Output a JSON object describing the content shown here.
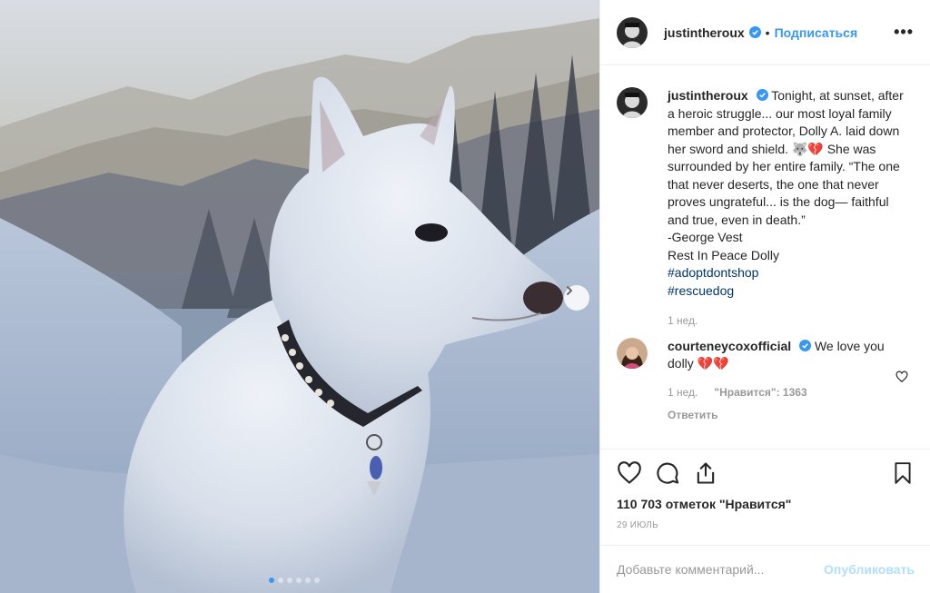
{
  "post": {
    "author": "justintheroux",
    "follow_label": "Подписаться",
    "separator": "•",
    "more_label": "•••"
  },
  "caption": {
    "author": "justintheroux",
    "text": "Tonight, at sunset, after a heroic struggle... our most loyal family member and protector, Dolly A. laid down her sword and shield. 🐺💔 She was surrounded by her entire family. “The one that never deserts, the one that never proves ungrateful... is the dog— faithful and true, even in death.”",
    "quote_author": "-George Vest",
    "rip": "Rest In Peace Dolly",
    "hashtags": [
      "#adoptdontshop",
      "#rescuedog"
    ],
    "time": "1 нед."
  },
  "comment": {
    "author": "courteneycoxofficial",
    "text": "We love you dolly 💔💔",
    "time": "1 нед.",
    "likes": "\"Нравится\": 1363",
    "reply_label": "Ответить"
  },
  "stats": {
    "likes": "110 703 отметок \"Нравится\"",
    "date": "29 ИЮЛЬ"
  },
  "add_comment": {
    "placeholder": "Добавьте комментарий...",
    "post_label": "Опубликовать"
  },
  "carousel": {
    "total": 6,
    "active": 1
  },
  "colors": {
    "accent": "#3897f0",
    "verified": "#3897f0",
    "hashtag": "#003569",
    "muted": "#999999"
  },
  "icons": [
    "chevron-right-icon",
    "verified-icon",
    "heart-icon",
    "comment-icon",
    "share-icon",
    "bookmark-icon",
    "more-icon"
  ]
}
